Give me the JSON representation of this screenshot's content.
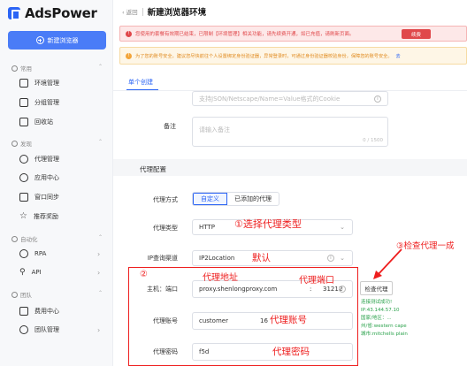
{
  "app": {
    "name": "AdsPower"
  },
  "sidebar": {
    "new_button": "新建浏览器",
    "sections": [
      {
        "label": "常用"
      },
      {
        "label": "发现"
      },
      {
        "label": "自动化"
      },
      {
        "label": "团队"
      }
    ],
    "items": [
      {
        "label": "环境管理",
        "icon": "browser-icon"
      },
      {
        "label": "分组管理",
        "icon": "folder-icon"
      },
      {
        "label": "回收站",
        "icon": "trash-icon"
      },
      {
        "label": "代理管理",
        "icon": "proxy-icon"
      },
      {
        "label": "应用中心",
        "icon": "app-center-icon"
      },
      {
        "label": "窗口同步",
        "icon": "sync-icon"
      },
      {
        "label": "推荐奖励",
        "icon": "star-icon"
      },
      {
        "label": "RPA",
        "icon": "robot-icon"
      },
      {
        "label": "API",
        "icon": "api-icon"
      },
      {
        "label": "费用中心",
        "icon": "billing-icon"
      },
      {
        "label": "团队管理",
        "icon": "team-icon"
      }
    ]
  },
  "header": {
    "back": "返回",
    "title": "新建浏览器环境"
  },
  "alerts": {
    "error": "您使用的套餐有效期已结束，已限制【环境管理】相关功能，请先续费开通，如已充值，请刷新页面。",
    "renew_button": "续费",
    "warning": "为了您的账号安全，建议您尽快前往个人设置绑定身份验证器，异常登录时，可通过身份验证器校验身份，保障您的账号安全。",
    "warning_link": "去"
  },
  "tabs": {
    "active": "单个创建"
  },
  "form": {
    "cookie_placeholder": "支持JSON/Netscape/Name=Value格式的Cookie",
    "remark_label": "备注",
    "remark_placeholder": "请输入备注",
    "remark_counter": "0 / 1500",
    "proxy_section": "代理配置",
    "proxy_mode_label": "代理方式",
    "proxy_mode_options": [
      "自定义",
      "已添加的代理"
    ],
    "proxy_type_label": "代理类型",
    "proxy_type_value": "HTTP",
    "ip_channel_label": "IP查询渠道",
    "ip_channel_value": "IP2Location",
    "host_label": "主机：端口",
    "host_value": "proxy.shenlongproxy.com",
    "port_sep": ":",
    "port_value": "31212",
    "account_label": "代理账号",
    "account_value": "customer",
    "account_value_tail": "16",
    "password_label": "代理密码",
    "password_value": "f5d",
    "check_button": "检查代理",
    "check_result": [
      "连接测试成功!",
      "IP:43.144.57.10",
      "国家/地区：...",
      "州/省:western cape",
      "城市:mitchells plain"
    ]
  },
  "annotations": {
    "step1": "①选择代理类型",
    "default": "默认",
    "step2_num": "②",
    "proxy_addr": "代理地址",
    "proxy_port": "代理端口",
    "proxy_account": "代理账号",
    "proxy_password": "代理密码",
    "step3": "③检查代理一成"
  },
  "colors": {
    "accent": "#2b64f5",
    "annotation": "#ee1e1e",
    "success": "#2ba24c",
    "error": "#e0484b",
    "warning": "#e08a1e"
  }
}
